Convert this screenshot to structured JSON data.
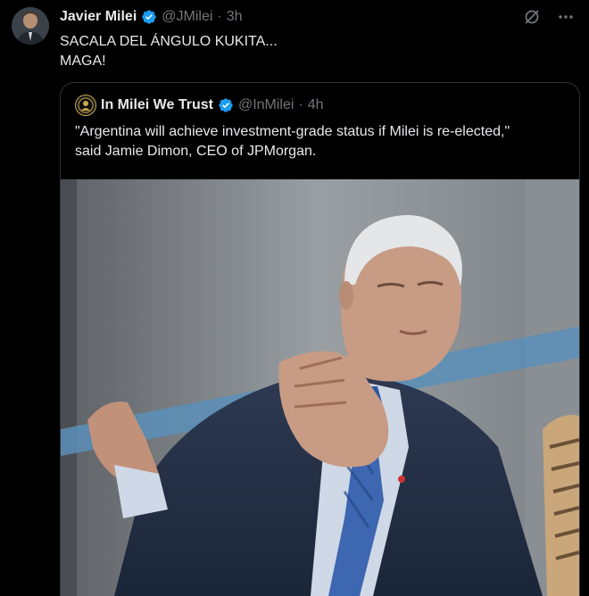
{
  "tweet": {
    "author_name": "Javier Milei",
    "handle": "@JMilei",
    "separator": "·",
    "time": "3h",
    "text": "SACALA DEL ÁNGULO KUKITA...\nMAGA!"
  },
  "quoted": {
    "author_name": "In Milei We Trust",
    "handle": "@InMilei",
    "separator": "·",
    "time": "4h",
    "text": "\"Argentina will achieve investment-grade status if Milei is re-elected,\"\nsaid Jamie Dimon, CEO of JPMorgan."
  },
  "icons": {
    "verified": "verified-badge-icon",
    "grok": "grok-icon",
    "more": "more-icon"
  },
  "colors": {
    "background": "#000000",
    "text": "#e7e9ea",
    "muted": "#71767b",
    "verified": "#1d9bf0",
    "border": "#2f3336"
  }
}
